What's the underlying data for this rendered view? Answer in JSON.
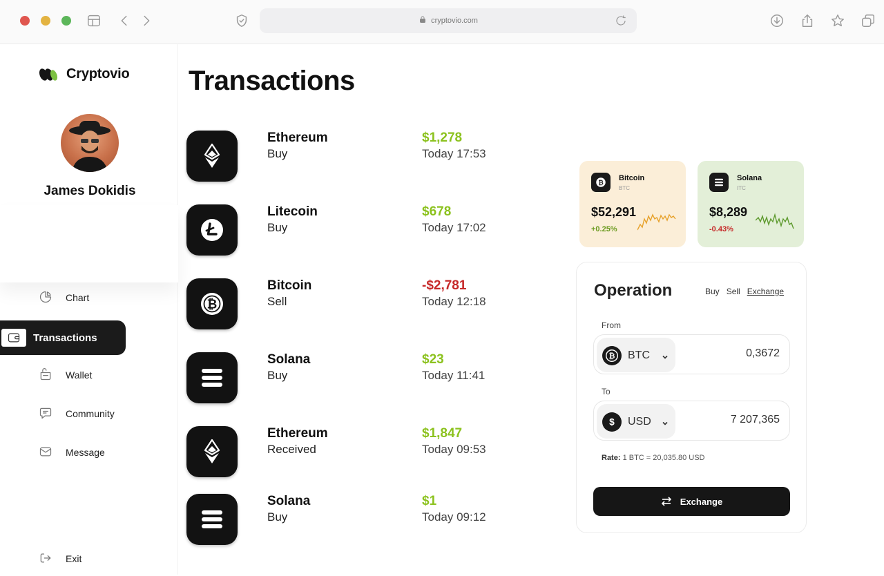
{
  "browser": {
    "url": "cryptovio.com",
    "traffic_colors": [
      "#e0564f",
      "#e3b341",
      "#5cb65a"
    ]
  },
  "app": {
    "name": "Cryptovio"
  },
  "user": {
    "name": "James Dokidis"
  },
  "nav": {
    "chart": "Chart",
    "transactions": "Transactions",
    "wallet": "Wallet",
    "community": "Community",
    "message": "Message",
    "exit": "Exit"
  },
  "page": {
    "title": "Transactions"
  },
  "transactions": [
    {
      "coin": "Ethereum",
      "type": "Buy",
      "amount": "$1,278",
      "time": "Today 17:53",
      "icon": "ethereum-icon",
      "color": "#8cc21f"
    },
    {
      "coin": "Litecoin",
      "type": "Buy",
      "amount": "$678",
      "time": "Today 17:02",
      "icon": "litecoin-icon",
      "color": "#8cc21f"
    },
    {
      "coin": "Bitcoin",
      "type": "Sell",
      "amount": "-$2,781",
      "time": "Today 12:18",
      "icon": "bitcoin-icon",
      "color": "#c62828"
    },
    {
      "coin": "Solana",
      "type": "Buy",
      "amount": "$23",
      "time": "Today 11:41",
      "icon": "solana-icon",
      "color": "#8cc21f"
    },
    {
      "coin": "Ethereum",
      "type": "Received",
      "amount": "$1,847",
      "time": "Today 09:53",
      "icon": "ethereum-icon",
      "color": "#8cc21f"
    },
    {
      "coin": "Solana",
      "type": "Buy",
      "amount": "$1",
      "time": "Today 09:12",
      "icon": "solana-icon",
      "color": "#8cc21f"
    }
  ],
  "cards": {
    "bitcoin": {
      "name": "Bitcoin",
      "ticker": "BTC",
      "price": "$52,291",
      "change": "+0.25%",
      "bg": "#fbeed8",
      "change_color": "#6a9a1e",
      "spark_color": "#e7a22c"
    },
    "solana": {
      "name": "Solana",
      "ticker": "ITC",
      "price": "$8,289",
      "change": "-0.43%",
      "bg": "#e3efd8",
      "change_color": "#c62828",
      "spark_color": "#5e9a2e"
    }
  },
  "operation": {
    "title": "Operation",
    "tabs": {
      "buy": "Buy",
      "sell": "Sell",
      "exchange": "Exchange"
    },
    "from_label": "From",
    "from_currency": "BTC",
    "from_amount": "0,3672",
    "to_label": "To",
    "to_currency": "USD",
    "to_amount": "7 207,365",
    "rate_label": "Rate:",
    "rate_value": "1 BTC = 20,035.80 USD",
    "button": "Exchange"
  }
}
